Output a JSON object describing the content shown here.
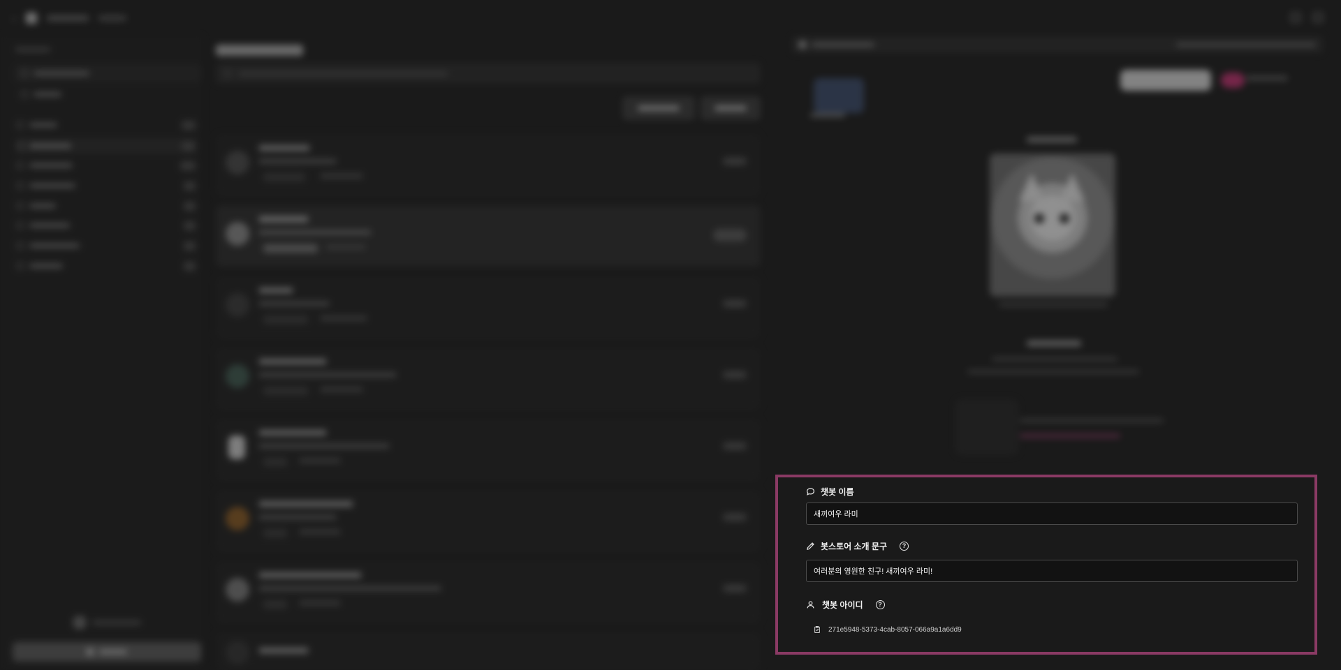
{
  "form": {
    "name_label": "챗봇 이름",
    "name_value": "새끼여우 라미",
    "intro_label": "봇스토어 소개 문구",
    "intro_value": "여러분의 영원한 친구! 새끼여우 라미!",
    "id_label": "챗봇 아이디",
    "id_value": "271e5948-5373-4cab-8057-066a9a1a6dd9"
  },
  "icons": {
    "name": "chat-bubble-icon",
    "intro": "pencil-icon",
    "id": "user-icon",
    "help": "question-circle-icon",
    "copy": "copy-icon"
  },
  "colors": {
    "highlight_border": "#8a3a64",
    "background": "#1a1a1a"
  }
}
